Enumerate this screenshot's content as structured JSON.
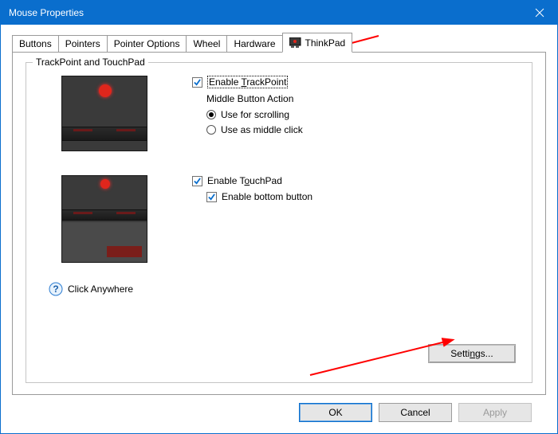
{
  "window": {
    "title": "Mouse Properties",
    "close_label": "Close"
  },
  "tabs": {
    "items": [
      {
        "label": "Buttons"
      },
      {
        "label": "Pointers"
      },
      {
        "label": "Pointer Options"
      },
      {
        "label": "Wheel"
      },
      {
        "label": "Hardware"
      },
      {
        "label": "ThinkPad"
      }
    ],
    "active_index": 5
  },
  "thinkpad": {
    "group_title": "TrackPoint and TouchPad",
    "enable_trackpoint_prefix": "Enable ",
    "enable_trackpoint_hot": "T",
    "enable_trackpoint_suffix": "rackPoint",
    "middle_action_label": "Middle Button Action",
    "use_scrolling_label": "Use for scrolling",
    "use_middleclick_label": "Use as middle click",
    "enable_touchpad_prefix": "Enable T",
    "enable_touchpad_hot": "o",
    "enable_touchpad_suffix": "uchPad",
    "enable_bottom_label": "Enable bottom button",
    "click_anywhere_label": "Click Anywhere",
    "settings_prefix": "Setti",
    "settings_hot": "n",
    "settings_suffix": "gs...",
    "trackpoint_checked": true,
    "touchpad_checked": true,
    "bottom_checked": true,
    "radio_selected": "scrolling"
  },
  "buttons": {
    "ok": "OK",
    "cancel": "Cancel",
    "apply": "Apply"
  }
}
